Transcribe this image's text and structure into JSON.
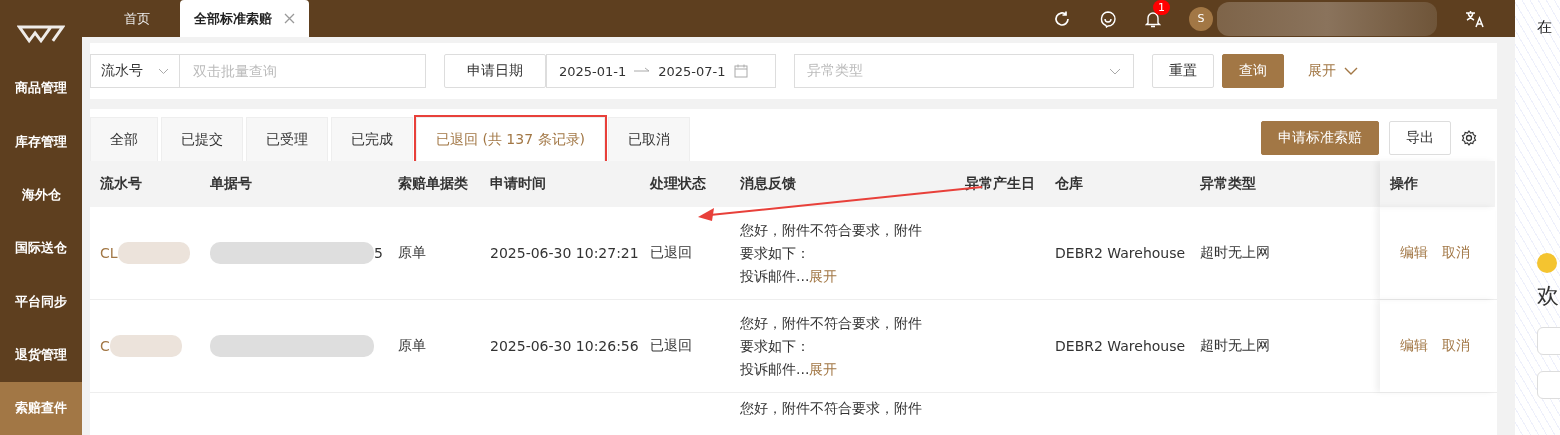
{
  "sidebar": {
    "items": [
      {
        "label": "商品管理",
        "selected": false
      },
      {
        "label": "库存管理",
        "selected": false
      },
      {
        "label": "海外仓",
        "selected": false
      },
      {
        "label": "国际送仓",
        "selected": false
      },
      {
        "label": "平台同步",
        "selected": false
      },
      {
        "label": "退货管理",
        "selected": false
      },
      {
        "label": "索赔查件",
        "selected": true
      }
    ]
  },
  "page_tabs": [
    {
      "label": "首页",
      "selected": false,
      "closable": false
    },
    {
      "label": "全部标准索赔",
      "selected": true,
      "closable": true
    }
  ],
  "header": {
    "notification_count": "1",
    "avatar_letter": "S"
  },
  "filters": {
    "field_select": "流水号",
    "search_placeholder": "双击批量查询",
    "date_label": "申请日期",
    "date_start": "2025-01-1",
    "date_end": "2025-07-1",
    "type_placeholder": "异常类型",
    "reset": "重置",
    "query": "查询",
    "expand": "展开"
  },
  "status_tabs": [
    {
      "label": "全部",
      "selected": false,
      "highlighted": false
    },
    {
      "label": "已提交",
      "selected": false,
      "highlighted": false
    },
    {
      "label": "已受理",
      "selected": false,
      "highlighted": false
    },
    {
      "label": "已完成",
      "selected": false,
      "highlighted": false
    },
    {
      "label": "已退回 (共 137 条记录)",
      "selected": true,
      "highlighted": true
    },
    {
      "label": "已取消",
      "selected": false,
      "highlighted": false
    }
  ],
  "actions": {
    "apply": "申请标准索赔",
    "export": "导出"
  },
  "table": {
    "columns": [
      "流水号",
      "单据号",
      "索赔单据类",
      "申请时间",
      "处理状态",
      "消息反馈",
      "异常产生日",
      "仓库",
      "异常类型",
      "操作"
    ],
    "rows": [
      {
        "serial": "CL",
        "document": "5",
        "claim_type": "原单",
        "time": "2025-06-30 10:27:21",
        "status": "已退回",
        "feedback": "您好，附件不符合要求，附件要求如下：",
        "feedback_more": "投诉邮件...",
        "expand": "展开",
        "warehouse": "DEBR2 Warehouse",
        "exception": "超时无上网",
        "edit": "编辑",
        "cancel": "取消"
      },
      {
        "serial": "C",
        "claim_type": "原单",
        "time": "2025-06-30 10:26:56",
        "status": "已退回",
        "feedback": "您好，附件不符合要求，附件要求如下：",
        "feedback_more": "投诉邮件...",
        "expand": "展开",
        "warehouse": "DEBR2 Warehouse",
        "exception": "超时无上网",
        "edit": "编辑",
        "cancel": "取消"
      },
      {
        "feedback": "您好，附件不符合要求，附件"
      }
    ]
  },
  "side_panel": {
    "title": "在",
    "greeting": "欢"
  }
}
